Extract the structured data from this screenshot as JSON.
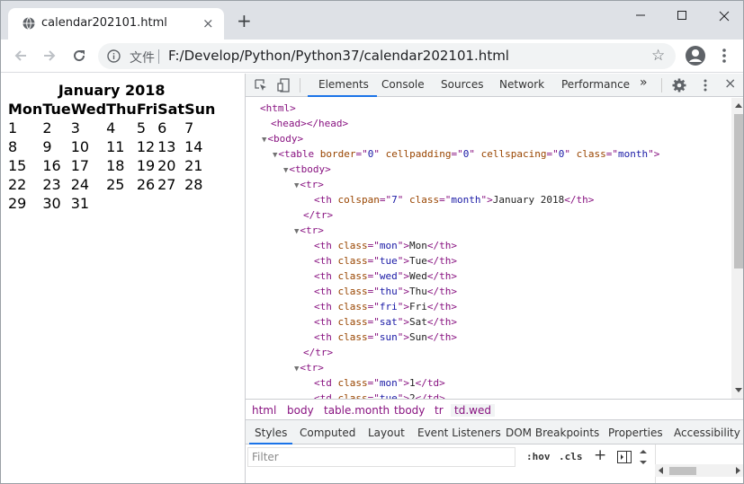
{
  "browser": {
    "tab_title": "calendar202101.html",
    "tab_close": "×",
    "new_tab": "+",
    "scheme_label": "文件",
    "url": "F:/Develop/Python/Python37/calendar202101.html",
    "star": "☆"
  },
  "page": {
    "month_title": "January 2018",
    "day_headers": [
      "Mon",
      "Tue",
      "Wed",
      "Thu",
      "Fri",
      "Sat",
      "Sun"
    ],
    "weeks": [
      [
        "1",
        "2",
        "3",
        "4",
        "5",
        "6",
        "7"
      ],
      [
        "8",
        "9",
        "10",
        "11",
        "12",
        "13",
        "14"
      ],
      [
        "15",
        "16",
        "17",
        "18",
        "19",
        "20",
        "21"
      ],
      [
        "22",
        "23",
        "24",
        "25",
        "26",
        "27",
        "28"
      ],
      [
        "29",
        "30",
        "31",
        "",
        "",
        "",
        ""
      ]
    ]
  },
  "devtools": {
    "tabs": [
      "Elements",
      "Console",
      "Sources",
      "Network",
      "Performance"
    ],
    "more": "»",
    "close": "×",
    "breadcrumbs": [
      "html",
      "body",
      "table.month",
      "tbody",
      "tr",
      "td.wed"
    ],
    "subtabs": [
      "Styles",
      "Computed",
      "Layout",
      "Event Listeners",
      "DOM Breakpoints",
      "Properties",
      "Accessibility"
    ],
    "filter_placeholder": "Filter",
    "hov": ":hov",
    "cls": ".cls",
    "plus": "+",
    "dom_lines": [
      {
        "indent": 0,
        "tri": "",
        "parts": [
          [
            "tag",
            "<html>"
          ]
        ]
      },
      {
        "indent": 1,
        "tri": "",
        "parts": [
          [
            "tag",
            "<head>"
          ],
          [
            "tag",
            "</head>"
          ]
        ]
      },
      {
        "indent": 1,
        "tri": "▼",
        "parts": [
          [
            "tag",
            "<body>"
          ]
        ]
      },
      {
        "indent": 2,
        "tri": "▼",
        "parts": [
          [
            "tag",
            "<table "
          ],
          [
            "an",
            "border"
          ],
          [
            "tag",
            "=\""
          ],
          [
            "av",
            "0"
          ],
          [
            "tag",
            "\" "
          ],
          [
            "an",
            "cellpadding"
          ],
          [
            "tag",
            "=\""
          ],
          [
            "av",
            "0"
          ],
          [
            "tag",
            "\" "
          ],
          [
            "an",
            "cellspacing"
          ],
          [
            "tag",
            "=\""
          ],
          [
            "av",
            "0"
          ],
          [
            "tag",
            "\" "
          ],
          [
            "an",
            "class"
          ],
          [
            "tag",
            "=\""
          ],
          [
            "av",
            "month"
          ],
          [
            "tag",
            "\">"
          ]
        ]
      },
      {
        "indent": 3,
        "tri": "▼",
        "parts": [
          [
            "tag",
            "<tbody>"
          ]
        ]
      },
      {
        "indent": 4,
        "tri": "▼",
        "parts": [
          [
            "tag",
            "<tr>"
          ]
        ]
      },
      {
        "indent": 5,
        "tri": "",
        "parts": [
          [
            "tag",
            "<th "
          ],
          [
            "an",
            "colspan"
          ],
          [
            "tag",
            "=\""
          ],
          [
            "av",
            "7"
          ],
          [
            "tag",
            "\" "
          ],
          [
            "an",
            "class"
          ],
          [
            "tag",
            "=\""
          ],
          [
            "av",
            "month"
          ],
          [
            "tag",
            "\">"
          ],
          [
            "tx",
            "January 2018"
          ],
          [
            "tag",
            "</th>"
          ]
        ]
      },
      {
        "indent": 4,
        "tri": "",
        "parts": [
          [
            "tag",
            "</tr>"
          ]
        ]
      },
      {
        "indent": 4,
        "tri": "▼",
        "parts": [
          [
            "tag",
            "<tr>"
          ]
        ]
      },
      {
        "indent": 5,
        "tri": "",
        "parts": [
          [
            "tag",
            "<th "
          ],
          [
            "an",
            "class"
          ],
          [
            "tag",
            "=\""
          ],
          [
            "av",
            "mon"
          ],
          [
            "tag",
            "\">"
          ],
          [
            "tx",
            "Mon"
          ],
          [
            "tag",
            "</th>"
          ]
        ]
      },
      {
        "indent": 5,
        "tri": "",
        "parts": [
          [
            "tag",
            "<th "
          ],
          [
            "an",
            "class"
          ],
          [
            "tag",
            "=\""
          ],
          [
            "av",
            "tue"
          ],
          [
            "tag",
            "\">"
          ],
          [
            "tx",
            "Tue"
          ],
          [
            "tag",
            "</th>"
          ]
        ]
      },
      {
        "indent": 5,
        "tri": "",
        "parts": [
          [
            "tag",
            "<th "
          ],
          [
            "an",
            "class"
          ],
          [
            "tag",
            "=\""
          ],
          [
            "av",
            "wed"
          ],
          [
            "tag",
            "\">"
          ],
          [
            "tx",
            "Wed"
          ],
          [
            "tag",
            "</th>"
          ]
        ]
      },
      {
        "indent": 5,
        "tri": "",
        "parts": [
          [
            "tag",
            "<th "
          ],
          [
            "an",
            "class"
          ],
          [
            "tag",
            "=\""
          ],
          [
            "av",
            "thu"
          ],
          [
            "tag",
            "\">"
          ],
          [
            "tx",
            "Thu"
          ],
          [
            "tag",
            "</th>"
          ]
        ]
      },
      {
        "indent": 5,
        "tri": "",
        "parts": [
          [
            "tag",
            "<th "
          ],
          [
            "an",
            "class"
          ],
          [
            "tag",
            "=\""
          ],
          [
            "av",
            "fri"
          ],
          [
            "tag",
            "\">"
          ],
          [
            "tx",
            "Fri"
          ],
          [
            "tag",
            "</th>"
          ]
        ]
      },
      {
        "indent": 5,
        "tri": "",
        "parts": [
          [
            "tag",
            "<th "
          ],
          [
            "an",
            "class"
          ],
          [
            "tag",
            "=\""
          ],
          [
            "av",
            "sat"
          ],
          [
            "tag",
            "\">"
          ],
          [
            "tx",
            "Sat"
          ],
          [
            "tag",
            "</th>"
          ]
        ]
      },
      {
        "indent": 5,
        "tri": "",
        "parts": [
          [
            "tag",
            "<th "
          ],
          [
            "an",
            "class"
          ],
          [
            "tag",
            "=\""
          ],
          [
            "av",
            "sun"
          ],
          [
            "tag",
            "\">"
          ],
          [
            "tx",
            "Sun"
          ],
          [
            "tag",
            "</th>"
          ]
        ]
      },
      {
        "indent": 4,
        "tri": "",
        "parts": [
          [
            "tag",
            "</tr>"
          ]
        ]
      },
      {
        "indent": 4,
        "tri": "▼",
        "parts": [
          [
            "tag",
            "<tr>"
          ]
        ]
      },
      {
        "indent": 5,
        "tri": "",
        "parts": [
          [
            "tag",
            "<td "
          ],
          [
            "an",
            "class"
          ],
          [
            "tag",
            "=\""
          ],
          [
            "av",
            "mon"
          ],
          [
            "tag",
            "\">"
          ],
          [
            "tx",
            "1"
          ],
          [
            "tag",
            "</td>"
          ]
        ]
      },
      {
        "indent": 5,
        "tri": "",
        "parts": [
          [
            "tag",
            "<td "
          ],
          [
            "an",
            "class"
          ],
          [
            "tag",
            "=\""
          ],
          [
            "av",
            "tue"
          ],
          [
            "tag",
            "\">"
          ],
          [
            "tx",
            "2"
          ],
          [
            "tag",
            "</td>"
          ]
        ]
      }
    ]
  }
}
